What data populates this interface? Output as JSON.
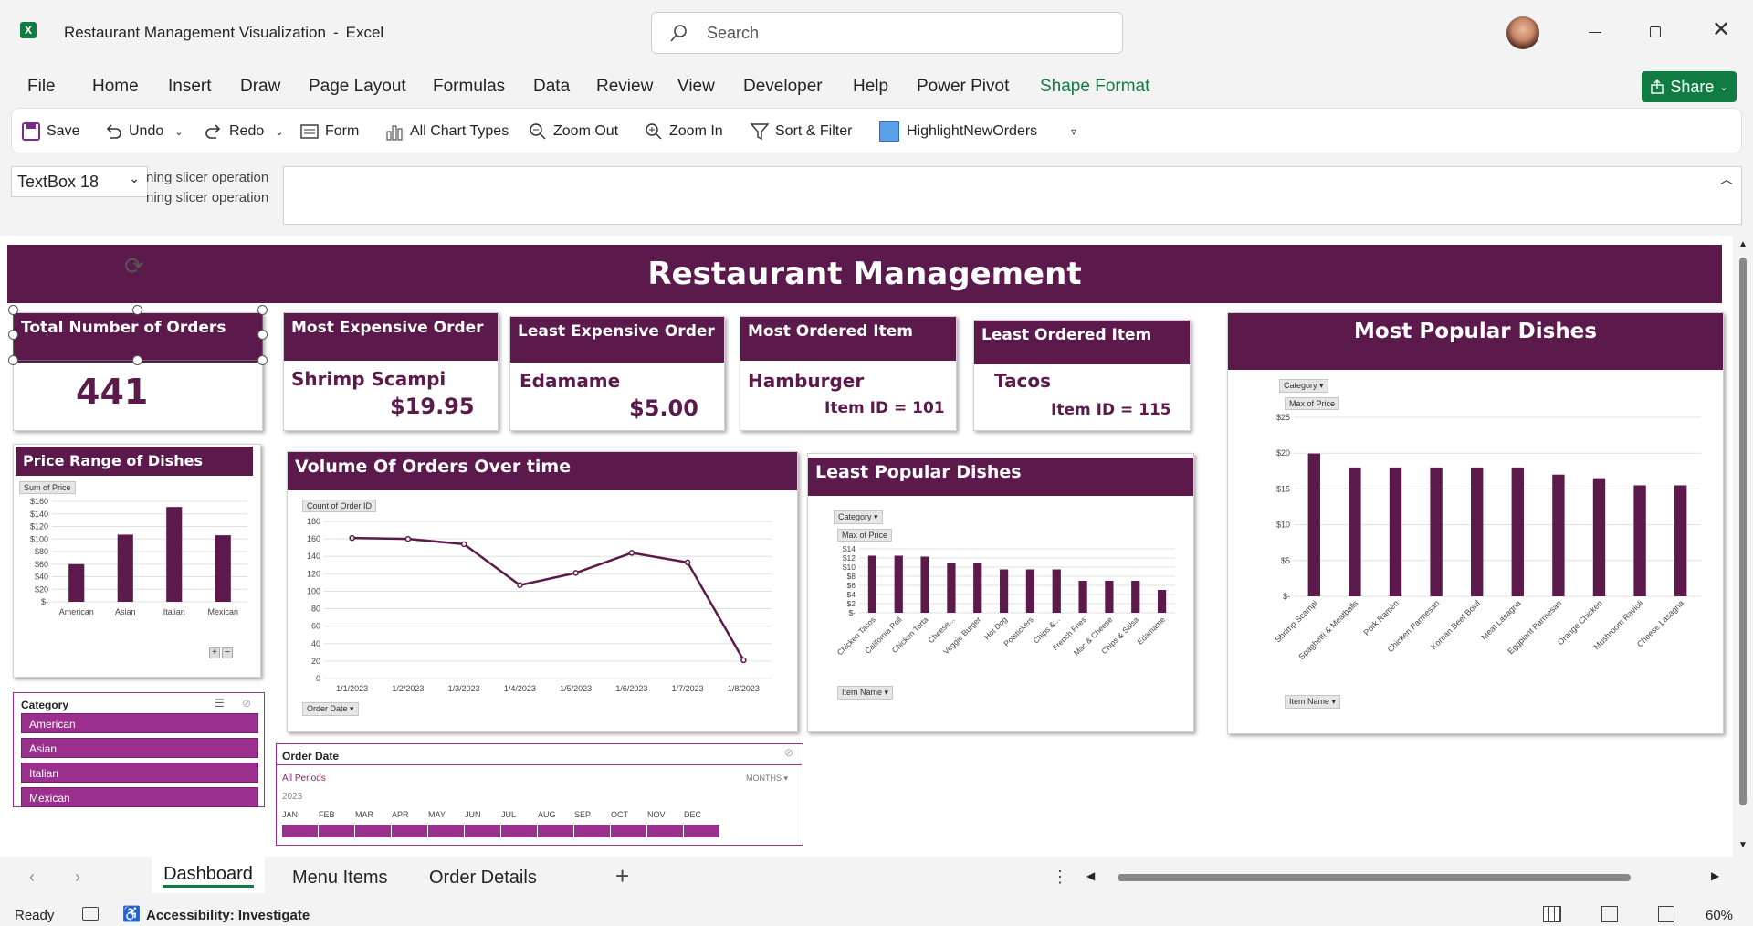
{
  "window": {
    "title": "Restaurant Management Visualization",
    "app_sep": "-",
    "app": "Excel",
    "search_placeholder": "Search"
  },
  "menu": [
    "File",
    "Home",
    "Insert",
    "Draw",
    "Page Layout",
    "Formulas",
    "Data",
    "Review",
    "View",
    "Developer",
    "Help",
    "Power Pivot",
    "Shape Format"
  ],
  "share_label": "Share",
  "ribbon": {
    "save": "Save",
    "undo": "Undo",
    "redo": "Redo",
    "form": "Form",
    "all_chart_types": "All Chart Types",
    "zoom_out": "Zoom Out",
    "zoom_in": "Zoom In",
    "sort_filter": "Sort & Filter",
    "highlight": "HighlightNewOrders"
  },
  "namebox": "TextBox 18",
  "formula_ghost_1": "ning slicer operation",
  "formula_ghost_2": "ning slicer operation",
  "dashboard": {
    "title": "Restaurant Management",
    "kpis": {
      "total": {
        "label": "Total Number of Orders",
        "value": "441"
      },
      "most_expensive": {
        "label": "Most Expensive Order",
        "item": "Shrimp Scampi",
        "price": "$19.95"
      },
      "least_expensive": {
        "label": "Least Expensive Order",
        "item": "Edamame",
        "price": "$5.00"
      },
      "most_ordered": {
        "label": "Most Ordered Item",
        "item": "Hamburger",
        "id": "Item ID = 101"
      },
      "least_ordered": {
        "label": "Least Ordered Item",
        "item": "Tacos",
        "id": "Item ID = 115"
      }
    },
    "price_range_title": "Price Range of Dishes",
    "volume_title": "Volume Of Orders Over time",
    "least_popular_title": "Least Popular Dishes",
    "most_popular_title": "Most Popular Dishes",
    "pivot_buttons": {
      "sum_price": "Sum of Price",
      "count_order": "Count of Order ID",
      "order_date": "Order Date",
      "category": "Category",
      "max_price": "Max of Price",
      "item_name": "Item Name"
    },
    "category_slicer": {
      "title": "Category",
      "items": [
        "American",
        "Asian",
        "Italian",
        "Mexican"
      ]
    },
    "date_slicer": {
      "title": "Order Date",
      "periods": "All Periods",
      "unit": "MONTHS",
      "year": "2023",
      "months": [
        "JAN",
        "FEB",
        "MAR",
        "APR",
        "MAY",
        "JUN",
        "JUL",
        "AUG",
        "SEP",
        "OCT",
        "NOV",
        "DEC"
      ]
    }
  },
  "chart_data": [
    {
      "type": "bar",
      "title": "Price Range of Dishes",
      "legend_button": "Sum of Price",
      "categories": [
        "American",
        "Asian",
        "Italian",
        "Mexican"
      ],
      "values": [
        60,
        107,
        151,
        106
      ],
      "ylim": [
        0,
        160
      ],
      "yticks": [
        "$-",
        "$20",
        "$40",
        "$60",
        "$80",
        "$100",
        "$120",
        "$140",
        "$160"
      ],
      "color": "#5b1a4b"
    },
    {
      "type": "line",
      "title": "Volume Of Orders Over time",
      "legend_button": "Count of Order ID",
      "categories": [
        "1/1/2023",
        "1/2/2023",
        "1/3/2023",
        "1/4/2023",
        "1/5/2023",
        "1/6/2023",
        "1/7/2023",
        "1/8/2023"
      ],
      "values": [
        161,
        160,
        154,
        107,
        121,
        144,
        133,
        21
      ],
      "ylim": [
        0,
        180
      ],
      "yticks": [
        "0",
        "20",
        "40",
        "60",
        "80",
        "100",
        "120",
        "140",
        "160",
        "180"
      ],
      "color": "#5b1a4b"
    },
    {
      "type": "bar",
      "title": "Least Popular Dishes",
      "legend_button": "Max of Price",
      "categories": [
        "Chicken Tacos",
        "California Roll",
        "Chicken Torta",
        "Cheese...",
        "Veggie Burger",
        "Hot Dog",
        "Potstickers",
        "Chips &...",
        "French Fries",
        "Mac & Cheese",
        "Chips & Salsa",
        "Edamame"
      ],
      "values": [
        12.5,
        12.5,
        12.3,
        11,
        11,
        9.5,
        9.5,
        9.5,
        7,
        7,
        7,
        5
      ],
      "ylim": [
        0,
        14
      ],
      "yticks": [
        "$-",
        "$2",
        "$4",
        "$6",
        "$8",
        "$10",
        "$12",
        "$14"
      ],
      "color": "#5b1a4b"
    },
    {
      "type": "bar",
      "title": "Most Popular Dishes",
      "legend_button": "Max of Price",
      "categories": [
        "Shrimp Scampi",
        "Spaghetti & Meatballs",
        "Pork Ramen",
        "Chicken Parmesan",
        "Korean Beef Bowl",
        "Meat Lasagna",
        "Eggplant Parmesan",
        "Orange Chicken",
        "Mushroom Ravioli",
        "Cheese Lasagna"
      ],
      "values": [
        19.95,
        18,
        18,
        18,
        18,
        18,
        17,
        16.5,
        15.5,
        15.5
      ],
      "ylim": [
        0,
        25
      ],
      "yticks": [
        "$-",
        "$5",
        "$10",
        "$15",
        "$20",
        "$25"
      ],
      "color": "#5b1a4b"
    }
  ],
  "sheet_tabs": [
    "Dashboard",
    "Menu Items",
    "Order Details"
  ],
  "status": {
    "ready": "Ready",
    "accessibility": "Accessibility: Investigate",
    "zoom": "60%"
  }
}
